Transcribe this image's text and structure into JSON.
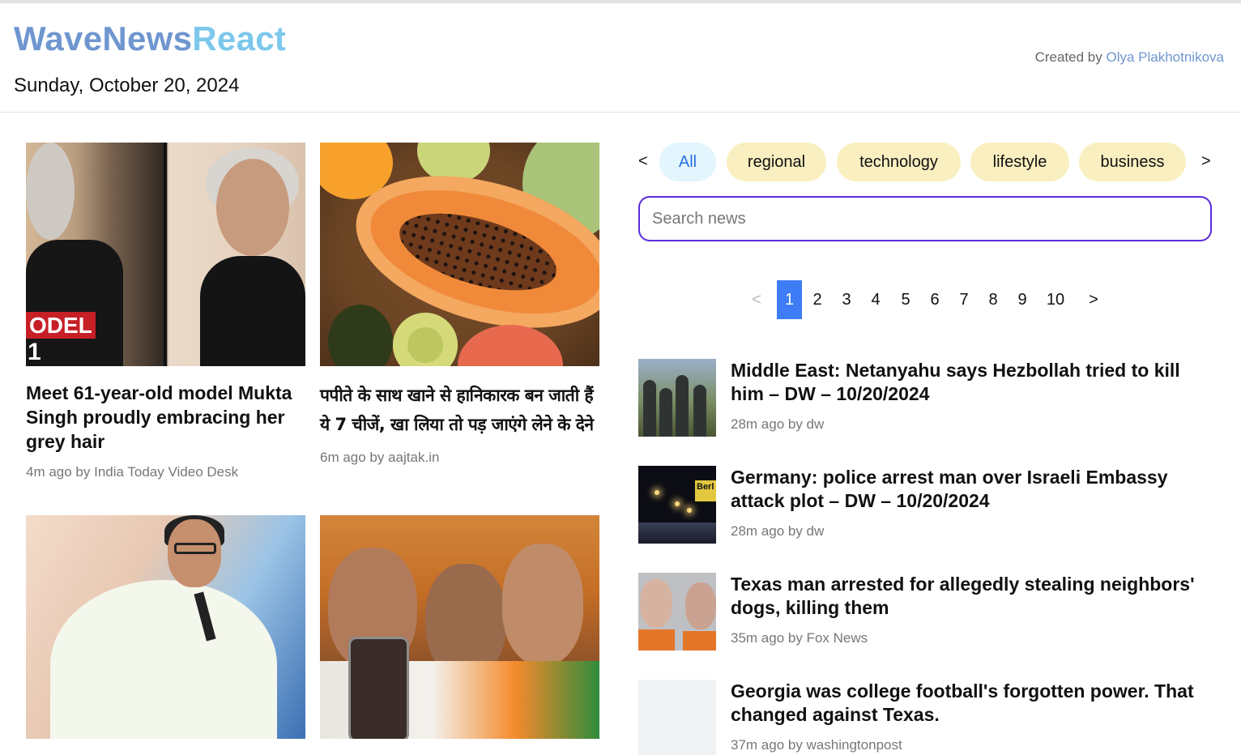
{
  "header": {
    "logo_part1": "WaveNews",
    "logo_part2": "React",
    "date": "Sunday, October 20, 2024",
    "credit_prefix": "Created by ",
    "credit_name": "Olya Plakhotnikova"
  },
  "cards": [
    {
      "title": "Meet 61-year-old model Mukta Singh proudly embracing her grey hair",
      "meta": "4m ago by India Today Video Desk",
      "image_overlay_1": "ODEL",
      "image_overlay_2": "1"
    },
    {
      "title": "पपीते के साथ खाने से हानिकारक बन जाती हैं ये 7 चीजें, खा लिया तो पड़ जाएंगे लेने के देने",
      "meta": "6m ago by aajtak.in"
    },
    {
      "title": "",
      "meta": ""
    },
    {
      "title": "",
      "meta": ""
    }
  ],
  "categories": {
    "prev": "<",
    "next": ">",
    "items": [
      "All",
      "regional",
      "technology",
      "lifestyle",
      "business"
    ],
    "active": "All"
  },
  "search": {
    "placeholder": "Search news",
    "value": ""
  },
  "pagination": {
    "prev": "<",
    "next": ">",
    "pages": [
      "1",
      "2",
      "3",
      "4",
      "5",
      "6",
      "7",
      "8",
      "9",
      "10"
    ],
    "current": "1"
  },
  "news_list": [
    {
      "title": "Middle East: Netanyahu says Hezbollah tried to kill him – DW – 10/20/2024",
      "meta": "28m ago by dw"
    },
    {
      "title": "Germany: police arrest man over Israeli Embassy attack plot – DW – 10/20/2024",
      "meta": "28m ago by dw",
      "thumb_sign": "Berl"
    },
    {
      "title": "Texas man arrested for allegedly stealing neighbors' dogs, killing them",
      "meta": "35m ago by Fox News"
    },
    {
      "title": "Georgia was college football's forgotten power. That changed against Texas.",
      "meta": "37m ago by washingtonpost"
    }
  ],
  "colors": {
    "logo_primary": "#6f96cf",
    "logo_accent": "#7cc8ec",
    "tab_bg": "#faefc0",
    "tab_active_bg": "#e3f5fd",
    "tab_active_text": "#2a6fe0",
    "search_border": "#5a2bdc",
    "page_active": "#3d7cf4"
  }
}
